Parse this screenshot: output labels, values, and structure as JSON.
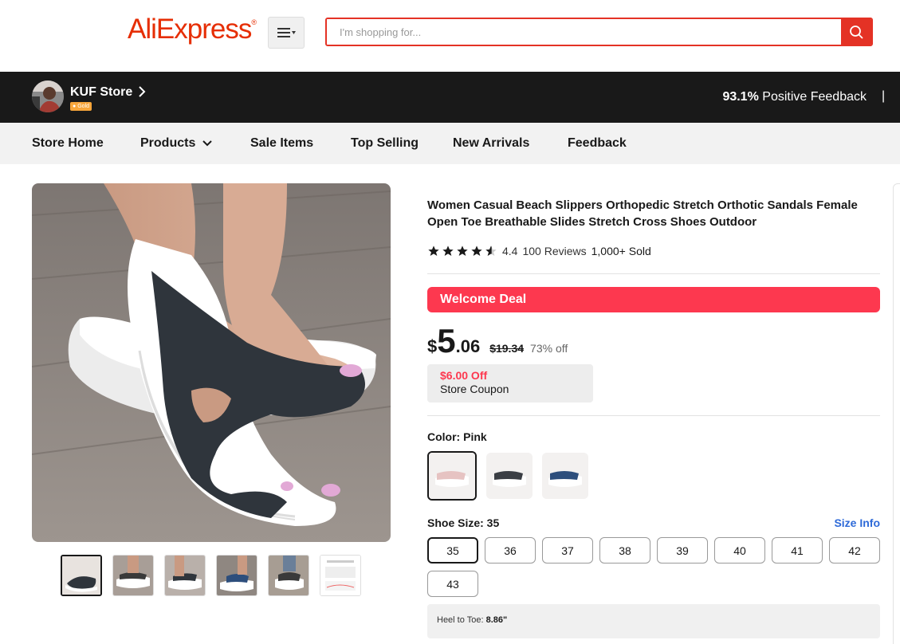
{
  "header": {
    "logo": "AliExpress",
    "search_placeholder": "I'm shopping for..."
  },
  "store": {
    "name": "KUF Store",
    "badge": "Gold",
    "feedback_percent": "93.1%",
    "feedback_label": "Positive Feedback",
    "separator": "|"
  },
  "nav": {
    "items": [
      "Store Home",
      "Products",
      "Sale Items",
      "Top Selling",
      "New Arrivals",
      "Feedback"
    ]
  },
  "product": {
    "title": "Women Casual Beach Slippers Orthopedic Stretch Orthotic Sandals Female Open Toe Breathable Slides Stretch Cross Shoes Outdoor",
    "rating": "4.4",
    "stars": 4.4,
    "reviews": "100 Reviews",
    "sold": "1,000+ Sold",
    "deal_label": "Welcome Deal",
    "price_currency": "$",
    "price_int": "5",
    "price_dec": ".06",
    "original_price": "$19.34",
    "discount": "73% off",
    "coupon_amount": "$6.00 Off",
    "coupon_label": "Store Coupon",
    "color_label": "Color: Pink",
    "colors": [
      "Pink",
      "Black",
      "Blue"
    ],
    "size_label": "Shoe Size: 35",
    "size_info": "Size Info",
    "sizes": [
      "35",
      "36",
      "37",
      "38",
      "39",
      "40",
      "41",
      "42",
      "43"
    ],
    "selected_size": "35",
    "heel_label": "Heel to Toe:",
    "heel_value": "8.86\""
  },
  "colors": {
    "brand_red": "#e43225",
    "deal_red": "#fd384f",
    "link_blue": "#2e6ad8",
    "store_bar": "#191919"
  }
}
